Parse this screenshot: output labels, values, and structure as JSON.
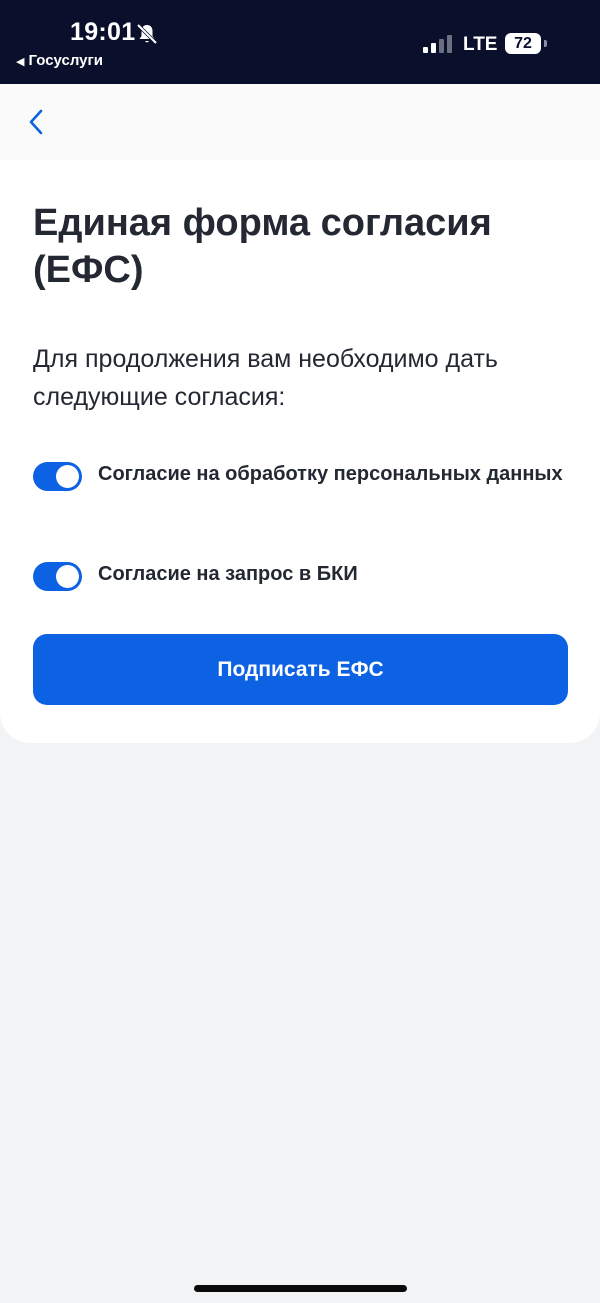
{
  "status_bar": {
    "time": "19:01",
    "back_app": "Госуслуги",
    "network": "LTE",
    "battery": "72",
    "silent_icon": "bell-slash-icon",
    "signal_icon": "cellular-signal-icon"
  },
  "nav": {
    "back_icon": "chevron-left-icon"
  },
  "main": {
    "title": "Единая форма согласия (ЕФС)",
    "description": "Для продолжения вам необходимо дать следующие согласия:",
    "consents": [
      {
        "label": "Согласие на обработку персональных данных",
        "enabled": true
      },
      {
        "label": "Согласие на запрос в БКИ",
        "enabled": true
      }
    ],
    "sign_button_label": "Подписать ЕФС"
  },
  "colors": {
    "status_bar_bg": "#0a0f2c",
    "accent": "#0d62e4",
    "text": "#232832",
    "page_bg": "#f2f3f5"
  }
}
